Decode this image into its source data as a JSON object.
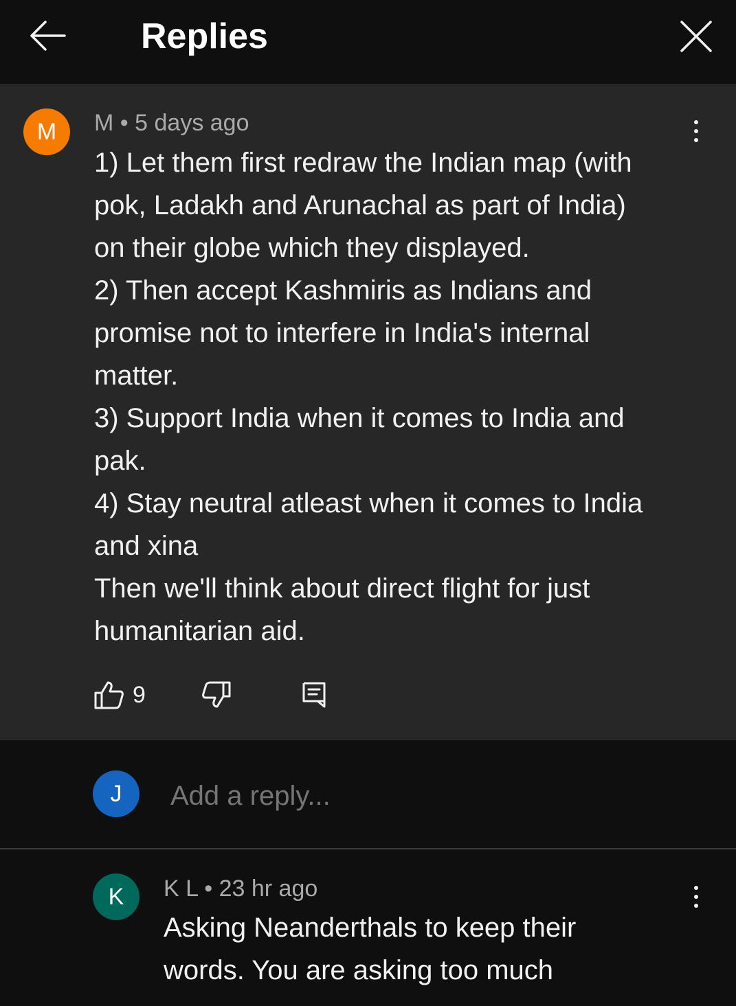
{
  "header": {
    "title": "Replies",
    "back_icon": "arrow-left-icon",
    "close_icon": "close-icon"
  },
  "comment": {
    "avatar_letter": "M",
    "avatar_color": "#f57c00",
    "author": "M",
    "separator": "•",
    "time": "5 days ago",
    "lines": [
      "1) Let them first redraw the Indian map (with",
      "pok, Ladakh and Arunachal as part of India)",
      "on their globe which they displayed.",
      "2) Then accept Kashmiris as Indians and",
      "promise not to interfere in India's internal",
      "matter.",
      "3) Support India when it comes to India and",
      "pak.",
      "4) Stay neutral atleast when it comes to India",
      "and xina",
      "Then we'll think about direct flight for just",
      "humanitarian aid."
    ],
    "like_count": "9"
  },
  "reply_box": {
    "avatar_letter": "J",
    "avatar_color": "#1565c0",
    "placeholder": "Add a reply..."
  },
  "reply": {
    "avatar_letter": "K",
    "avatar_color": "#00695c",
    "author": "K L",
    "separator": "•",
    "time": "23 hr ago",
    "lines": [
      "Asking Neanderthals to keep their",
      "words. You are asking too much"
    ]
  }
}
